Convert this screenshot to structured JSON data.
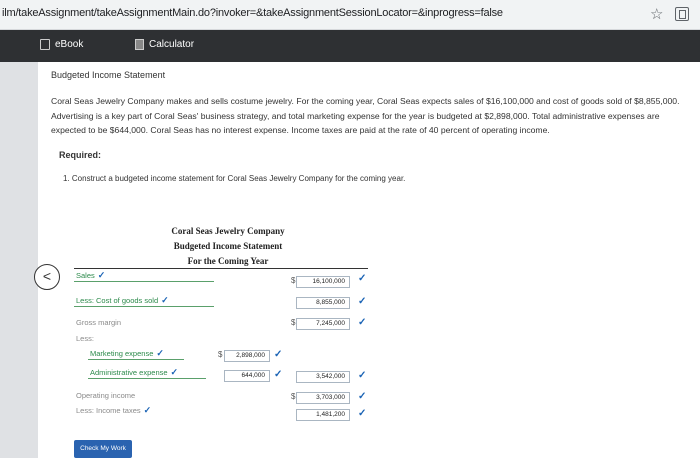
{
  "browser": {
    "url": "ilm/takeAssignment/takeAssignmentMain.do?invoker=&takeAssignmentSessionLocator=&inprogress=false"
  },
  "toolbar": {
    "ebook_label": "eBook",
    "calculator_label": "Calculator"
  },
  "problem": {
    "heading": "Budgeted Income Statement",
    "paragraph": "Coral Seas Jewelry Company makes and sells costume jewelry. For the coming year, Coral Seas expects sales of $16,100,000 and cost of goods sold of $8,855,000. Advertising is a key part of Coral Seas' business strategy, and total marketing expense for the year is budgeted at $2,898,000. Total administrative expenses are expected to be $644,000. Coral Seas has no interest expense. Income taxes are paid at the rate of 40 percent of operating income.",
    "required_label": "Required:",
    "question": "1. Construct a budgeted income statement for Coral Seas Jewelry Company for the coming year."
  },
  "statement": {
    "company": "Coral Seas Jewelry Company",
    "title": "Budgeted Income Statement",
    "period": "For the Coming Year",
    "rows": {
      "sales": {
        "label": "Sales",
        "value": "16,100,000"
      },
      "cogs": {
        "label": "Less: Cost of goods sold",
        "value": "8,855,000"
      },
      "gross_margin": {
        "label": "Gross margin",
        "value": "7,245,000"
      },
      "less": {
        "label": "Less:"
      },
      "marketing": {
        "label": "Marketing expense",
        "value": "2,898,000"
      },
      "admin": {
        "label": "Administrative expense",
        "value": "644,000",
        "total": "3,542,000"
      },
      "operating": {
        "label": "Operating income",
        "value": "3,703,000"
      },
      "taxes": {
        "label": "Less: Income taxes",
        "value": "1,481,200"
      }
    },
    "dollar_sign": "$",
    "check_mark": "✓"
  },
  "buttons": {
    "back": "<",
    "check_my_work": "Check My Work"
  },
  "colors": {
    "toolbar_bg": "#2e3033",
    "correct_label": "#2c8a4b",
    "check_mark": "#1a63b5",
    "button_bg": "#2a63b0"
  }
}
